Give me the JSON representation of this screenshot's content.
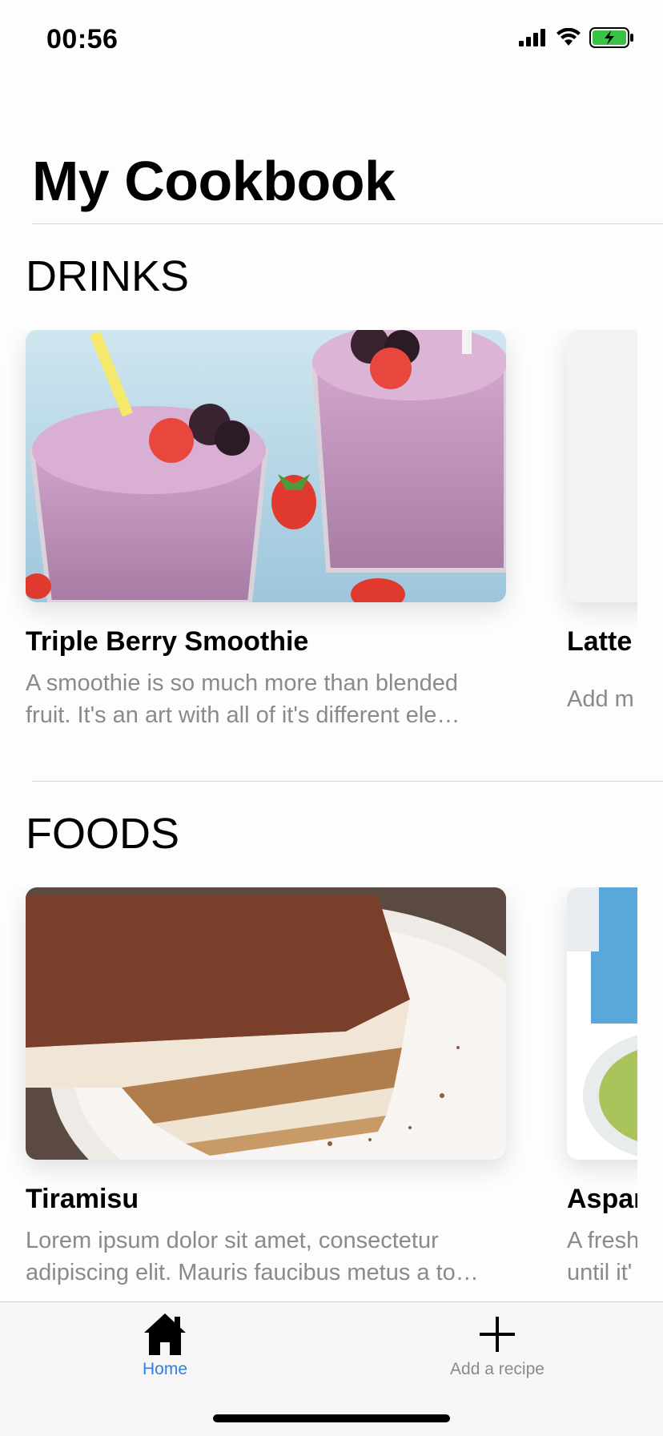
{
  "status_bar": {
    "time": "00:56"
  },
  "header": {
    "title": "My Cookbook"
  },
  "sections": [
    {
      "title": "DRINKS",
      "cards": [
        {
          "name": "Triple Berry Smoothie",
          "description": "A smoothie is so much more than blended fruit. It's an art with all of it's different ele…",
          "image": "berry-smoothie-photo"
        },
        {
          "name": "Latte",
          "description": "Add m",
          "image": "placeholder"
        }
      ]
    },
    {
      "title": "FOODS",
      "cards": [
        {
          "name": "Tiramisu",
          "description": "Lorem ipsum dolor sit amet, consectetur adipiscing elit. Mauris faucibus metus a to…",
          "image": "tiramisu-photo"
        },
        {
          "name": "Aspar",
          "description": "A fresh until it'",
          "image": "asparagus-soup-photo"
        }
      ]
    }
  ],
  "tab_bar": {
    "tabs": [
      {
        "label": "Home",
        "icon": "home-icon",
        "active": true
      },
      {
        "label": "Add a recipe",
        "icon": "plus-icon",
        "active": false
      }
    ],
    "active_color": "#2f7fe6",
    "inactive_color": "#8a8a8a"
  }
}
